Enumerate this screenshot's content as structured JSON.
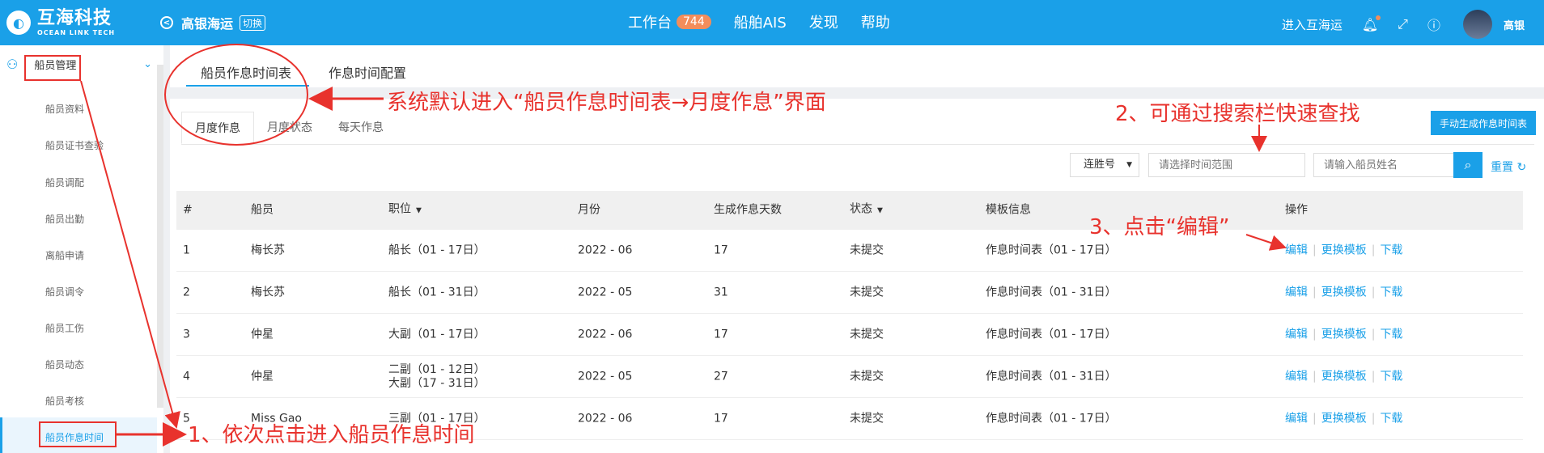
{
  "header": {
    "logo_text": "互海科技",
    "logo_sub": "OCEAN LINK TECH",
    "company": "高银海运",
    "switch_label": "切换",
    "nav": [
      {
        "label": "工作台",
        "badge": "744"
      },
      {
        "label": "船舶AIS"
      },
      {
        "label": "发现"
      },
      {
        "label": "帮助"
      }
    ],
    "enter_label": "进入互海运",
    "user_name": "高银"
  },
  "sidebar": {
    "group_label": "船员管理",
    "items": [
      "船员资料",
      "船员证书查验",
      "船员调配",
      "船员出勤",
      "离船申请",
      "船员调令",
      "船员工伤",
      "船员动态",
      "船员考核",
      "船员作息时间"
    ]
  },
  "tabs": [
    "船员作息时间表",
    "作息时间配置"
  ],
  "subtabs": [
    "月度作息",
    "月度状态",
    "每天作息"
  ],
  "toolbar": {
    "generate_button": "手动生成作息时间表",
    "ship_select": "连胜号",
    "time_placeholder": "请选择时间范围",
    "name_placeholder": "请输入船员姓名",
    "reset_label": "重置"
  },
  "table": {
    "columns": [
      "#",
      "船员",
      "职位",
      "月份",
      "生成作息天数",
      "状态",
      "模板信息",
      "操作"
    ],
    "rows": [
      {
        "idx": "1",
        "name": "梅长苏",
        "pos": [
          "船长（01 - 17日）"
        ],
        "month": "2022 - 06",
        "days": "17",
        "status": "未提交",
        "template": "作息时间表（01 - 17日）"
      },
      {
        "idx": "2",
        "name": "梅长苏",
        "pos": [
          "船长（01 - 31日）"
        ],
        "month": "2022 - 05",
        "days": "31",
        "status": "未提交",
        "template": "作息时间表（01 - 31日）"
      },
      {
        "idx": "3",
        "name": "仲星",
        "pos": [
          "大副（01 - 17日）"
        ],
        "month": "2022 - 06",
        "days": "17",
        "status": "未提交",
        "template": "作息时间表（01 - 17日）"
      },
      {
        "idx": "4",
        "name": "仲星",
        "pos": [
          "二副（01 - 12日）",
          "大副（17 - 31日）"
        ],
        "month": "2022 - 05",
        "days": "27",
        "status": "未提交",
        "template": "作息时间表（01 - 31日）"
      },
      {
        "idx": "5",
        "name": "Miss Gao",
        "pos": [
          "三副（01 - 17日）"
        ],
        "month": "2022 - 06",
        "days": "17",
        "status": "未提交",
        "template": "作息时间表（01 - 17日）"
      }
    ],
    "actions": [
      "编辑",
      "更换模板",
      "下载"
    ]
  },
  "annotations": {
    "a1": "1、依次点击进入船员作息时间",
    "a_default": "系统默认进入“船员作息时间表→月度作息”界面",
    "a2": "2、可通过搜索栏快速查找",
    "a3": "3、点击“编辑”"
  },
  "colors": {
    "accent": "#1aa0e8",
    "annotation": "#e8322d",
    "badge": "#f38d5b"
  }
}
